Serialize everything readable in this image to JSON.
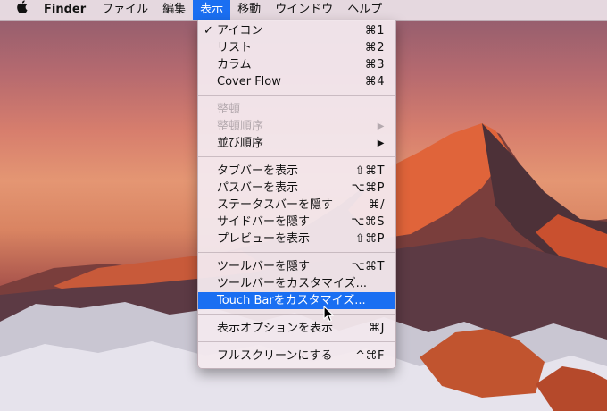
{
  "menubar": {
    "app_name": "Finder",
    "items": [
      "ファイル",
      "編集",
      "表示",
      "移動",
      "ウインドウ",
      "ヘルプ"
    ],
    "active_item": "表示"
  },
  "menu": {
    "groups": [
      [
        {
          "label": "アイコン",
          "shortcut": "⌘1",
          "checked": true
        },
        {
          "label": "リスト",
          "shortcut": "⌘2"
        },
        {
          "label": "カラム",
          "shortcut": "⌘3"
        },
        {
          "label": "Cover Flow",
          "shortcut": "⌘4"
        }
      ],
      [
        {
          "label": "整頓",
          "shortcut": "",
          "disabled": true
        },
        {
          "label": "整頓順序",
          "shortcut": "",
          "disabled": true,
          "submenu": true
        },
        {
          "label": "並び順序",
          "shortcut": "",
          "submenu": true
        }
      ],
      [
        {
          "label": "タブバーを表示",
          "shortcut": "⇧⌘T"
        },
        {
          "label": "パスバーを表示",
          "shortcut": "⌥⌘P"
        },
        {
          "label": "ステータスバーを隠す",
          "shortcut": "⌘/"
        },
        {
          "label": "サイドバーを隠す",
          "shortcut": "⌥⌘S"
        },
        {
          "label": "プレビューを表示",
          "shortcut": "⇧⌘P"
        }
      ],
      [
        {
          "label": "ツールバーを隠す",
          "shortcut": "⌥⌘T"
        },
        {
          "label": "ツールバーをカスタマイズ...",
          "shortcut": ""
        },
        {
          "label": "Touch Barをカスタマイズ...",
          "shortcut": "",
          "highlighted": true
        }
      ],
      [
        {
          "label": "表示オプションを表示",
          "shortcut": "⌘J"
        }
      ],
      [
        {
          "label": "フルスクリーンにする",
          "shortcut": "^⌘F"
        }
      ]
    ],
    "check_glyph": "✓",
    "submenu_glyph": "▶"
  },
  "icons": {
    "apple": "apple-logo-icon",
    "cursor": "arrow-pointer-icon"
  },
  "colors": {
    "highlight": "#1a6ff2",
    "menu_bg": "#f3e9ee",
    "disabled_text": "#b4a9ae"
  }
}
